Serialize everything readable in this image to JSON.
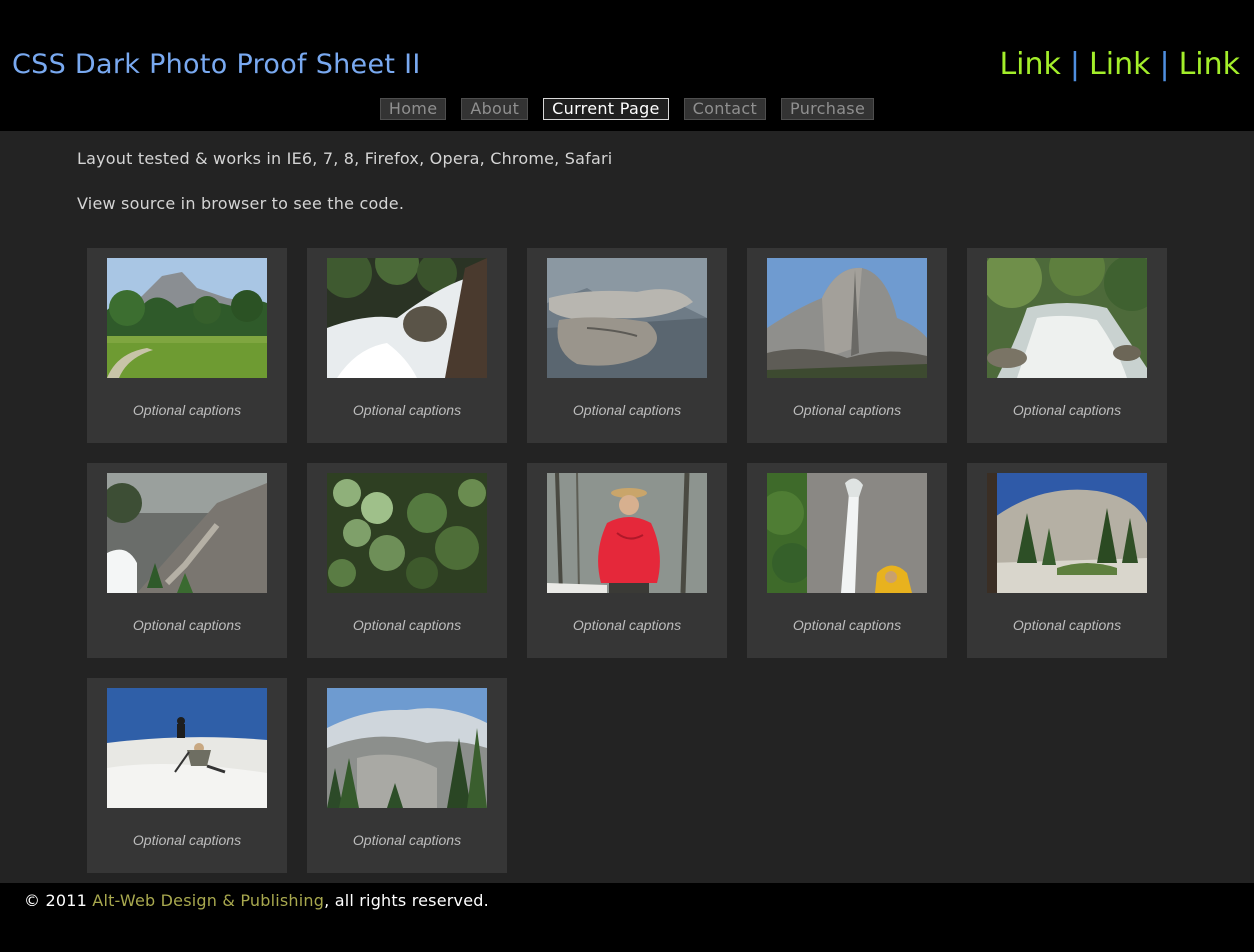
{
  "header": {
    "title": "CSS Dark Photo Proof Sheet II",
    "links": [
      "Link",
      "Link",
      "Link"
    ],
    "separator": "|"
  },
  "nav": {
    "items": [
      "Home",
      "About",
      "Current Page",
      "Contact",
      "Purchase"
    ],
    "current": "Current Page"
  },
  "intro": {
    "line1": "Layout tested & works in IE6, 7, 8, Firefox, Opera, Chrome, Safari",
    "line2": "View source in browser to see the code."
  },
  "gallery": {
    "photos": [
      {
        "subject": "half-dome-meadow",
        "caption": "Optional captions"
      },
      {
        "subject": "rushing-cascade",
        "caption": "Optional captions"
      },
      {
        "subject": "overhanging-rock",
        "caption": "Optional captions"
      },
      {
        "subject": "half-dome",
        "caption": "Optional captions"
      },
      {
        "subject": "mountain-river",
        "caption": "Optional captions"
      },
      {
        "subject": "mist-trail-steps",
        "caption": "Optional captions"
      },
      {
        "subject": "mossy-plants",
        "caption": "Optional captions"
      },
      {
        "subject": "hiker-red-poncho",
        "caption": "Optional captions"
      },
      {
        "subject": "waterfall-yellow-hood",
        "caption": "Optional captions"
      },
      {
        "subject": "granite-dome-pines",
        "caption": "Optional captions"
      },
      {
        "subject": "snow-field-hiker",
        "caption": "Optional captions"
      },
      {
        "subject": "snowy-peak-vista",
        "caption": "Optional captions"
      }
    ]
  },
  "footer": {
    "prefix": "© 2011 ",
    "company": "Alt-Web Design & Publishing",
    "suffix": ", all rights reserved."
  },
  "colors": {
    "background": "#232323",
    "header_bg": "#000000",
    "title": "#79a9f0",
    "links": "#a3ee2a",
    "card": "#363636",
    "company_link": "#a8a84e"
  }
}
